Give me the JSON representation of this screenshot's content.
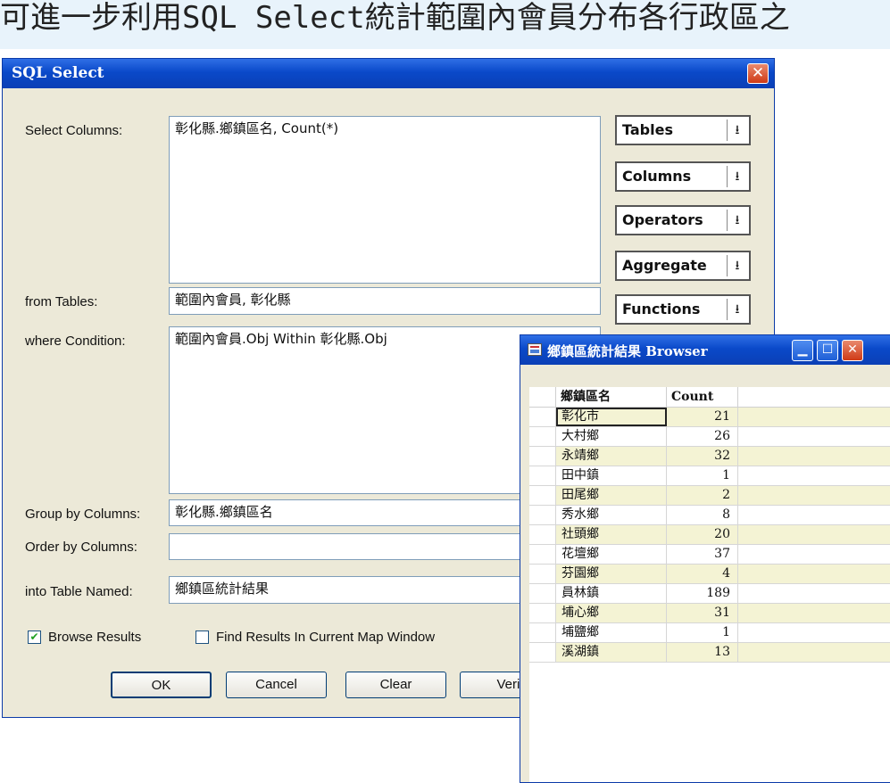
{
  "page": {
    "heading": "可進一步利用SQL Select統計範圍內會員分布各行政區之"
  },
  "dialog": {
    "title": "SQL Select",
    "labels": {
      "select_columns": "Select Columns:",
      "from_tables": "from Tables:",
      "where_condition": "where Condition:",
      "group_by": "Group by Columns:",
      "order_by": "Order by Columns:",
      "into_table": "into Table Named:"
    },
    "values": {
      "select_columns": "彰化縣.鄉鎮區名, Count(*)",
      "from_tables": "範圍內會員, 彰化縣",
      "where_condition": "範圍內會員.Obj Within 彰化縣.Obj",
      "group_by": "彰化縣.鄉鎮區名",
      "order_by": "",
      "into_table": "鄉鎮區統計結果"
    },
    "dropdowns": [
      "Tables",
      "Columns",
      "Operators",
      "Aggregate",
      "Functions"
    ],
    "checkboxes": {
      "browse_results": {
        "label": "Browse Results",
        "checked": true
      },
      "find_results": {
        "label": "Find Results In Current Map Window",
        "checked": false
      }
    },
    "buttons": {
      "ok": "OK",
      "cancel": "Cancel",
      "clear": "Clear",
      "verify": "Verif"
    }
  },
  "browser": {
    "title": "鄉鎮區統計結果 Browser",
    "columns": [
      "鄉鎮區名",
      "Count"
    ],
    "rows": [
      {
        "name": "彰化市",
        "count": "21"
      },
      {
        "name": "大村鄉",
        "count": "26"
      },
      {
        "name": "永靖鄉",
        "count": "32"
      },
      {
        "name": "田中鎮",
        "count": "1"
      },
      {
        "name": "田尾鄉",
        "count": "2"
      },
      {
        "name": "秀水鄉",
        "count": "8"
      },
      {
        "name": "社頭鄉",
        "count": "20"
      },
      {
        "name": "花壇鄉",
        "count": "37"
      },
      {
        "name": "芬園鄉",
        "count": "4"
      },
      {
        "name": "員林鎮",
        "count": "189"
      },
      {
        "name": "埔心鄉",
        "count": "31"
      },
      {
        "name": "埔鹽鄉",
        "count": "1"
      },
      {
        "name": "溪湖鎮",
        "count": "13"
      }
    ]
  }
}
